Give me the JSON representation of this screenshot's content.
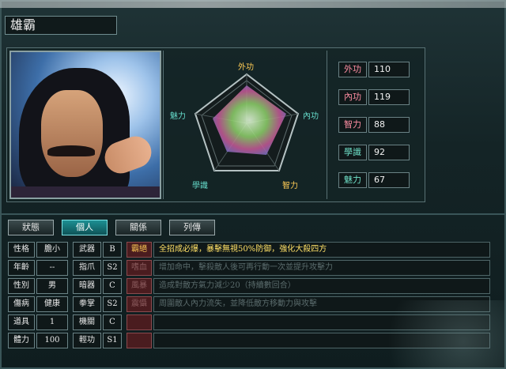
{
  "character": {
    "name": "雄霸"
  },
  "radar": {
    "labels": {
      "top": "外功",
      "right": "內功",
      "bottom_right": "智力",
      "bottom_left": "學識",
      "left": "魅力"
    }
  },
  "stats": [
    {
      "label": "外功",
      "value": "110"
    },
    {
      "label": "內功",
      "value": "119"
    },
    {
      "label": "智力",
      "value": "88"
    },
    {
      "label": "學識",
      "value": "92"
    },
    {
      "label": "魅力",
      "value": "67"
    }
  ],
  "tabs": [
    "狀態",
    "個人",
    "關係",
    "列傳"
  ],
  "active_tab": "個人",
  "attributes": [
    {
      "label": "性格",
      "value": "膽小",
      "skill": "武器",
      "grade": "B"
    },
    {
      "label": "年齡",
      "value": "--",
      "skill": "指爪",
      "grade": "S2"
    },
    {
      "label": "性別",
      "value": "男",
      "skill": "暗器",
      "grade": "C"
    },
    {
      "label": "傷病",
      "value": "健康",
      "skill": "拳掌",
      "grade": "S2"
    },
    {
      "label": "道具",
      "value": "1",
      "skill": "機關",
      "grade": "C"
    },
    {
      "label": "體力",
      "value": "100",
      "skill": "輕功",
      "grade": "S1"
    }
  ],
  "skills": [
    {
      "tag": "霸絕",
      "desc": "全招成必爆，暴擊無視50%防御，強化大殺四方"
    },
    {
      "tag": "嗜血",
      "desc": "增加命中，擊殺敵人後可再行動一次並提升攻擊力"
    },
    {
      "tag": "風暴",
      "desc": "造成對敵方氣力減少20（持續數回合）"
    },
    {
      "tag": "震懾",
      "desc": "周圍敵人內力流失，並降低敵方移動力與攻擊"
    },
    {
      "tag": "",
      "desc": ""
    },
    {
      "tag": "",
      "desc": ""
    }
  ],
  "colors": {
    "accent": "#1d8f93",
    "stat_label": "#ff8ea3",
    "skill_highlight": "#ffe066"
  }
}
